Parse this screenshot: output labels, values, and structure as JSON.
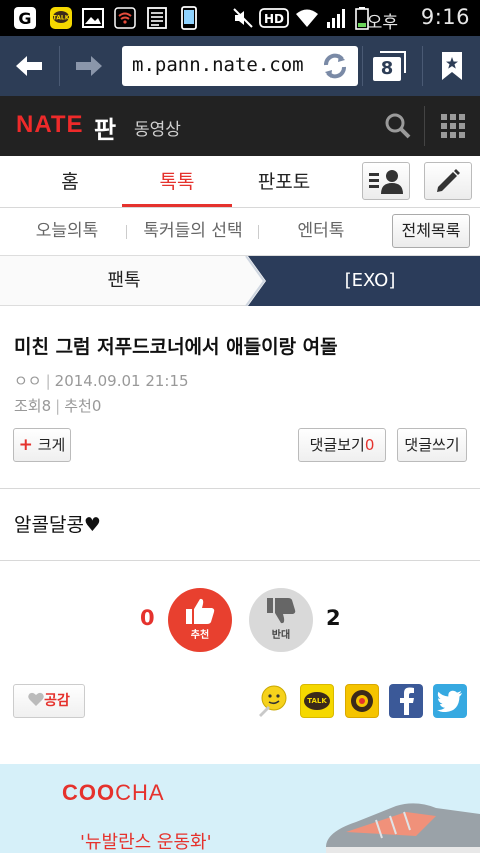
{
  "status_bar": {
    "ampm": "오후",
    "time": "9:16",
    "icons": [
      "g-icon",
      "talk-icon",
      "gallery-icon",
      "wifi-alert-icon",
      "note-icon",
      "phone-icon",
      "mute-icon",
      "hd-icon",
      "wifi-icon",
      "signal-icon",
      "battery-icon"
    ]
  },
  "browser": {
    "url": "m.pann.nate.com",
    "tab_count": "8",
    "colors": {
      "bar": "#2d3d56"
    }
  },
  "header": {
    "logo": "NATE",
    "pan": "판",
    "video": "동영상"
  },
  "main_tabs": [
    {
      "label": "홈",
      "active": false
    },
    {
      "label": "톡톡",
      "active": true
    },
    {
      "label": "판포토",
      "active": false
    }
  ],
  "sub_tabs": [
    {
      "label": "오늘의톡"
    },
    {
      "label": "톡커들의 선택"
    },
    {
      "label": "엔터톡"
    }
  ],
  "all_list_label": "전체목록",
  "breadcrumb": {
    "left": "팬톡",
    "right": "[EXO]"
  },
  "article": {
    "title": "미친 그럼 저푸드코너에서 애들이랑 여돌",
    "author": "ㅇㅇ",
    "date": "2014.09.01 21:15",
    "views": "조회8",
    "recommends": "추천0",
    "font_bigger": "크게",
    "comments_view_label": "댓글보기",
    "comments_count": "0",
    "comment_write": "댓글쓰기",
    "body": "알콜달콩♥"
  },
  "vote": {
    "up_count": "0",
    "up_label": "추천",
    "down_count": "2",
    "down_label": "반대",
    "colors": {
      "up": "#e8402f",
      "down": "#d9d9d9"
    }
  },
  "share": {
    "like_label": "공감",
    "targets": [
      "emoticon-share-icon",
      "kakaotalk-icon",
      "kakaostory-icon",
      "facebook-icon",
      "twitter-icon"
    ],
    "talk_text": "TALK"
  },
  "ad": {
    "brand_coo": "COO",
    "brand_cha": "CHA",
    "text": "'뉴발란스 운동화'"
  }
}
